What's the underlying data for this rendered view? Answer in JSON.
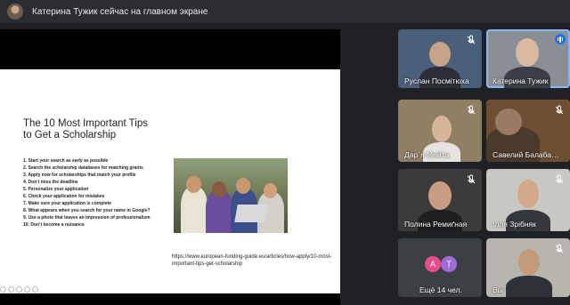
{
  "notification": {
    "text": "Катерина Тужик сейчас на главном экране"
  },
  "slide": {
    "title": "The 10 Most Important Tips to Get a Scholarship",
    "tips": [
      "1. Start your search as early as possible",
      "2. Search the scholarship databases for matching grants",
      "3. Apply now for scholarships that match your profile",
      "4. Don’t miss the deadline",
      "5. Personalize your application",
      "6. Check your application for mistakes",
      "7. Make sure your application is complete",
      "8. What appears when you search for your name in Google?",
      "9. Use a photo that leaves an impression of professionalism",
      "10. Don’t become a nuisance"
    ],
    "url": "https://www.european-funding-guide.eu/articles/how-apply/10-most-important-tips-get-scholarship"
  },
  "participants": [
    {
      "name": "Руслан Посмітюха",
      "muted": true
    },
    {
      "name": "Катерина Тужик",
      "speaking": true
    },
    {
      "name": "Дар`я Мейта",
      "muted": true
    },
    {
      "name": "Савелий Балаба…",
      "muted": true
    },
    {
      "name": "Полина Ремиґная",
      "muted": true
    },
    {
      "name": "Ілля Зрібняк",
      "muted": true
    },
    {
      "name": "Ещё 14 чел.",
      "initials": [
        "А",
        "Т"
      ]
    },
    {
      "name": "Вы",
      "muted": true
    }
  ],
  "colors": {
    "accent": "#1a73e8",
    "avatar_a": "#ea4c89",
    "avatar_t": "#9e6ad7"
  }
}
